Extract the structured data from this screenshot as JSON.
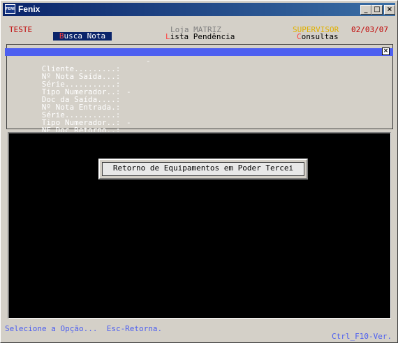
{
  "window": {
    "title": "Fenix",
    "icon": "FENIX",
    "controls": {
      "minimize": "_",
      "maximize": "□",
      "close": "×"
    }
  },
  "header": {
    "user": "TESTE",
    "store": "Loja MATRIZ",
    "role": "SUPERVISOR",
    "date": "02/03/07"
  },
  "menu": {
    "items": [
      {
        "hotkey": "B",
        "rest": "usca Nota"
      },
      {
        "hotkey": "L",
        "rest": "ista Pendência"
      },
      {
        "hotkey": "C",
        "rest": "onsultas"
      }
    ]
  },
  "form": {
    "close_label": "×",
    "fields": [
      {
        "label": "Cliente.........:",
        "value": "-"
      },
      {
        "label": "Nº Nota Saída...:",
        "value": ""
      },
      {
        "label": "Série...........:",
        "value": ""
      },
      {
        "label": "Tipo Numerador..:",
        "value": ""
      },
      {
        "label": "Doc da Saída....:",
        "value": "-"
      },
      {
        "label": "Nº Nota Entrada.:",
        "value": ""
      },
      {
        "label": "Série...........:",
        "value": ""
      },
      {
        "label": "Tipo Numerador..:",
        "value": ""
      },
      {
        "label": "NF Doc Retorno..:",
        "value": "-"
      }
    ]
  },
  "dialog": {
    "text": "Retorno de Equipamentos em Poder Tercei"
  },
  "status": {
    "prompt": "Selecione a Opção...  Esc-Retorna.",
    "version": "Ctrl_F10-Ver."
  }
}
